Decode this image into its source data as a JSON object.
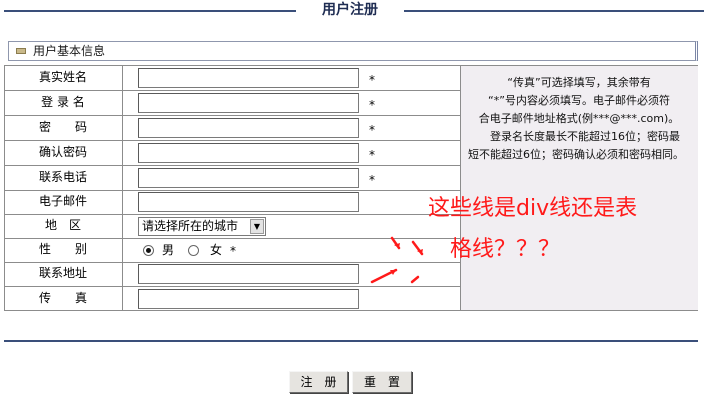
{
  "page": {
    "title": "用户注册",
    "section_title": "用户基本信息"
  },
  "form": {
    "fields": [
      {
        "label": "真实姓名",
        "value": "",
        "required": "*"
      },
      {
        "label": "登 录 名",
        "value": "",
        "required": "*"
      },
      {
        "label": "密　　码",
        "value": "",
        "required": "*"
      },
      {
        "label": "确认密码",
        "value": "",
        "required": "*"
      },
      {
        "label": "联系电话",
        "value": "",
        "required": "*"
      },
      {
        "label": "电子邮件",
        "value": ""
      }
    ],
    "region": {
      "label": "地　区",
      "selected": "请选择所在的城市"
    },
    "gender": {
      "label": "性　　别",
      "male": "男",
      "female": "女",
      "required": "*",
      "selected": "男"
    },
    "address": {
      "label": "联系地址",
      "value": ""
    },
    "fax": {
      "label": "传　　真",
      "value": ""
    }
  },
  "notes": {
    "line1": "“传真”可选择填写，其余带有",
    "line2": "“*”号内容必须填写。电子邮件必须符",
    "line3": "合电子邮件地址格式(例***@***.com)。",
    "para2": "登录名长度最长不能超过16位；密码最短不能超过6位；密码确认必须和密码相同。"
  },
  "buttons": {
    "register": "注　册",
    "reset": "重　置"
  },
  "annotation": {
    "line1": "这些线是div线还是表",
    "line2": "格线？？？",
    "color": "#ff1a1a"
  },
  "colors": {
    "rule": "#3a4f7a",
    "notes_bg": "#f1eef2",
    "title": "#1e2c52"
  }
}
